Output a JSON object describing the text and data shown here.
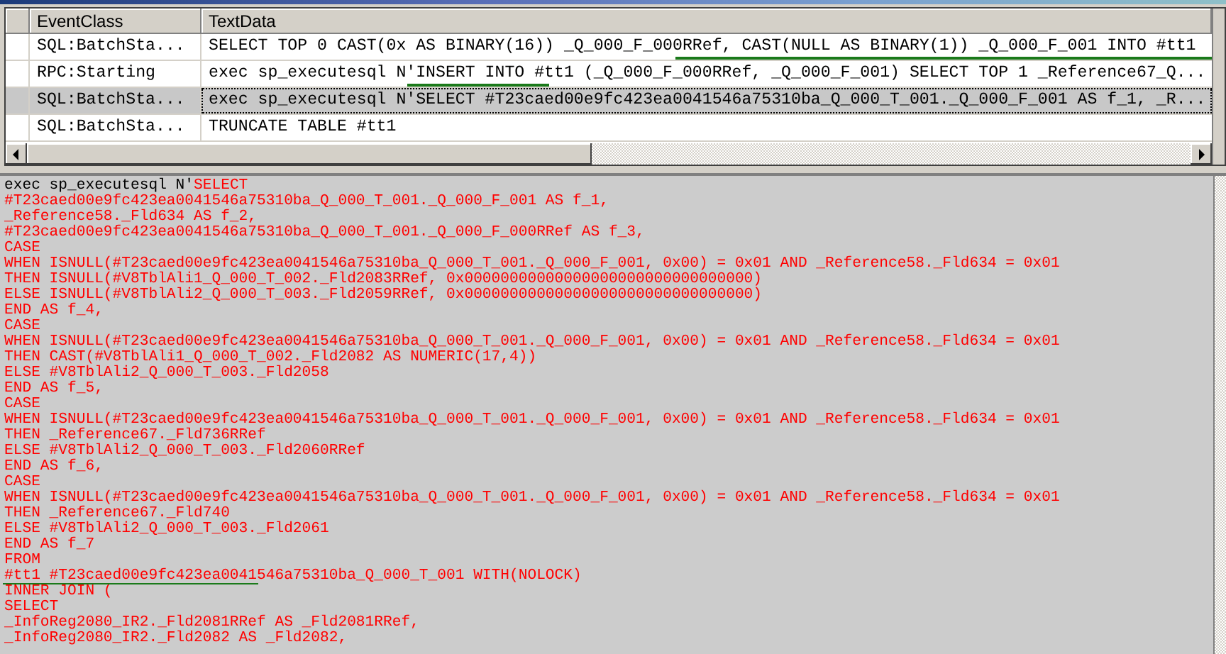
{
  "trace_table": {
    "columns": [
      "EventClass",
      "TextData"
    ],
    "rows": [
      {
        "event_class": "SQL:BatchSta...",
        "text_data": "SELECT TOP 0 CAST(0x AS BINARY(16)) _Q_000_F_000RRef, CAST(NULL AS BINARY(1)) _Q_000_F_001 INTO #tt1",
        "selected": false
      },
      {
        "event_class": "RPC:Starting",
        "text_data": "exec sp_executesql N'INSERT INTO #tt1 (_Q_000_F_000RRef, _Q_000_F_001) SELECT TOP 1 _Reference67_Q...",
        "selected": false
      },
      {
        "event_class": "SQL:BatchSta...",
        "text_data": "exec sp_executesql N'SELECT #T23caed00e9fc423ea0041546a75310ba_Q_000_T_001._Q_000_F_001 AS f_1, _R...",
        "selected": true
      },
      {
        "event_class": "SQL:BatchSta...",
        "text_data": "TRUNCATE TABLE #tt1",
        "selected": false
      }
    ]
  },
  "detail": {
    "prefix": "exec sp_executesql N'",
    "lines": [
      "SELECT",
      "#T23caed00e9fc423ea0041546a75310ba_Q_000_T_001._Q_000_F_001 AS f_1,",
      "_Reference58._Fld634 AS f_2,",
      "#T23caed00e9fc423ea0041546a75310ba_Q_000_T_001._Q_000_F_000RRef AS f_3,",
      "CASE",
      "WHEN ISNULL(#T23caed00e9fc423ea0041546a75310ba_Q_000_T_001._Q_000_F_001, 0x00) = 0x01 AND _Reference58._Fld634 = 0x01",
      "THEN ISNULL(#V8TblAli1_Q_000_T_002._Fld2083RRef, 0x00000000000000000000000000000000)",
      "ELSE ISNULL(#V8TblAli2_Q_000_T_003._Fld2059RRef, 0x00000000000000000000000000000000)",
      "END AS f_4,",
      "CASE",
      "WHEN ISNULL(#T23caed00e9fc423ea0041546a75310ba_Q_000_T_001._Q_000_F_001, 0x00) = 0x01 AND _Reference58._Fld634 = 0x01",
      "THEN CAST(#V8TblAli1_Q_000_T_002._Fld2082 AS NUMERIC(17,4))",
      "ELSE #V8TblAli2_Q_000_T_003._Fld2058",
      "END AS f_5,",
      "CASE",
      "WHEN ISNULL(#T23caed00e9fc423ea0041546a75310ba_Q_000_T_001._Q_000_F_001, 0x00) = 0x01 AND _Reference58._Fld634 = 0x01",
      "THEN _Reference67._Fld736RRef",
      "ELSE #V8TblAli2_Q_000_T_003._Fld2060RRef",
      "END AS f_6,",
      "CASE",
      "WHEN ISNULL(#T23caed00e9fc423ea0041546a75310ba_Q_000_T_001._Q_000_F_001, 0x00) = 0x01 AND _Reference58._Fld634 = 0x01",
      "THEN _Reference67._Fld740",
      "ELSE #V8TblAli2_Q_000_T_003._Fld2061",
      "END AS f_7",
      "FROM",
      "#tt1 #T23caed00e9fc423ea0041546a75310ba_Q_000_T_001 WITH(NOLOCK)",
      "INNER JOIN (",
      "SELECT",
      "_InfoReg2080_IR2._Fld2081RRef AS _Fld2081RRef,",
      "_InfoReg2080_IR2._Fld2082 AS _Fld2082,"
    ]
  }
}
